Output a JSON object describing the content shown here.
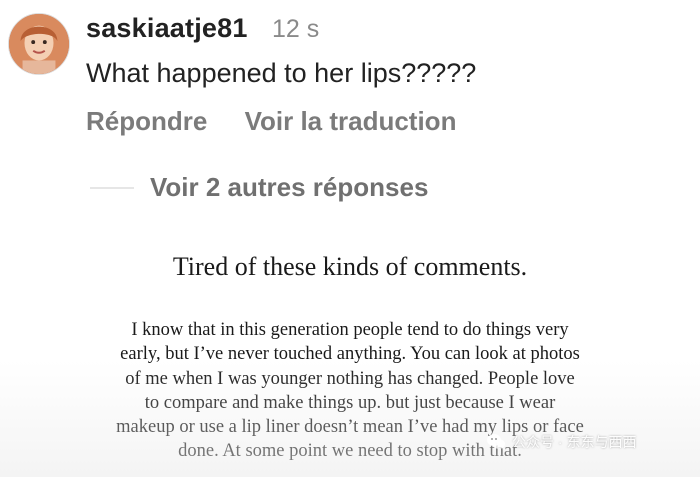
{
  "comment": {
    "username": "saskiaatje81",
    "time": "12 s",
    "text": "What happened to her lips?????",
    "reply_label": "Répondre",
    "translate_label": "Voir la traduction",
    "more_replies_label": "Voir 2 autres réponses"
  },
  "statement": {
    "title": "Tired  of these kinds of comments.",
    "lines": [
      "I know that in this generation people tend to do things very",
      "early, but I’ve never touched anything. You can look at photos",
      "of me when I was younger  nothing has changed. People love",
      "to compare and make things up. but just because I wear",
      "makeup or use a lip liner doesn’t mean I’ve had my lips or face",
      "done. At some point we need to stop with that."
    ]
  },
  "watermark": {
    "text": "公众号 · 东东与西西",
    "icon": "wechat-icon"
  }
}
